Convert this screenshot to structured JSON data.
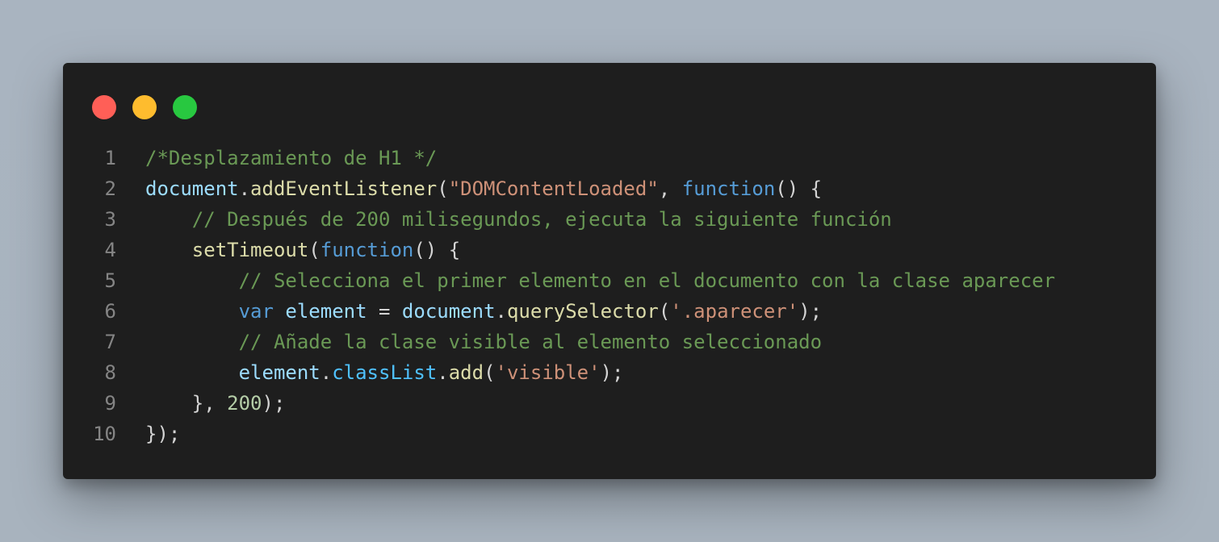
{
  "window": {
    "controls": [
      {
        "name": "close",
        "color": "#ff5f57"
      },
      {
        "name": "minimize",
        "color": "#febc2e"
      },
      {
        "name": "maximize",
        "color": "#28c840"
      }
    ]
  },
  "code": {
    "language": "javascript",
    "lines": [
      {
        "number": "1",
        "tokens": [
          {
            "t": "/*Desplazamiento de H1 */",
            "c": "comment"
          }
        ]
      },
      {
        "number": "2",
        "tokens": [
          {
            "t": "document",
            "c": "var"
          },
          {
            "t": ".",
            "c": "punc"
          },
          {
            "t": "addEventListener",
            "c": "fn"
          },
          {
            "t": "(",
            "c": "punc"
          },
          {
            "t": "\"DOMContentLoaded\"",
            "c": "str"
          },
          {
            "t": ", ",
            "c": "punc"
          },
          {
            "t": "function",
            "c": "kw"
          },
          {
            "t": "() {",
            "c": "punc"
          }
        ]
      },
      {
        "number": "3",
        "tokens": [
          {
            "t": "    ",
            "c": "punc"
          },
          {
            "t": "// Después de 200 milisegundos, ejecuta la siguiente función",
            "c": "comment"
          }
        ]
      },
      {
        "number": "4",
        "tokens": [
          {
            "t": "    ",
            "c": "punc"
          },
          {
            "t": "setTimeout",
            "c": "fn"
          },
          {
            "t": "(",
            "c": "punc"
          },
          {
            "t": "function",
            "c": "kw"
          },
          {
            "t": "() {",
            "c": "punc"
          }
        ]
      },
      {
        "number": "5",
        "tokens": [
          {
            "t": "        ",
            "c": "punc"
          },
          {
            "t": "// Selecciona el primer elemento en el documento con la clase aparecer",
            "c": "comment"
          }
        ]
      },
      {
        "number": "6",
        "tokens": [
          {
            "t": "        ",
            "c": "punc"
          },
          {
            "t": "var",
            "c": "kw"
          },
          {
            "t": " ",
            "c": "punc"
          },
          {
            "t": "element",
            "c": "var"
          },
          {
            "t": " = ",
            "c": "punc"
          },
          {
            "t": "document",
            "c": "var"
          },
          {
            "t": ".",
            "c": "punc"
          },
          {
            "t": "querySelector",
            "c": "fn"
          },
          {
            "t": "(",
            "c": "punc"
          },
          {
            "t": "'.aparecer'",
            "c": "str"
          },
          {
            "t": ");",
            "c": "punc"
          }
        ]
      },
      {
        "number": "7",
        "tokens": [
          {
            "t": "        ",
            "c": "punc"
          },
          {
            "t": "// Añade la clase visible al elemento seleccionado",
            "c": "comment"
          }
        ]
      },
      {
        "number": "8",
        "tokens": [
          {
            "t": "        ",
            "c": "punc"
          },
          {
            "t": "element",
            "c": "var"
          },
          {
            "t": ".",
            "c": "punc"
          },
          {
            "t": "classList",
            "c": "prop"
          },
          {
            "t": ".",
            "c": "punc"
          },
          {
            "t": "add",
            "c": "fn"
          },
          {
            "t": "(",
            "c": "punc"
          },
          {
            "t": "'visible'",
            "c": "str"
          },
          {
            "t": ");",
            "c": "punc"
          }
        ]
      },
      {
        "number": "9",
        "tokens": [
          {
            "t": "    }, ",
            "c": "punc"
          },
          {
            "t": "200",
            "c": "num"
          },
          {
            "t": ");",
            "c": "punc"
          }
        ]
      },
      {
        "number": "10",
        "tokens": [
          {
            "t": "});",
            "c": "punc"
          }
        ]
      }
    ]
  }
}
